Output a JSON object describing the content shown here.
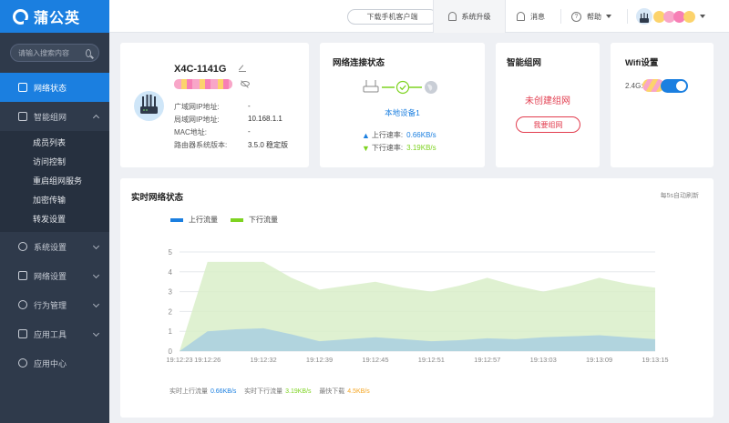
{
  "brand": {
    "name": "蒲公英",
    "accent": "#1b7fe0"
  },
  "search": {
    "placeholder": "请输入搜索内容"
  },
  "sidebar": {
    "items": [
      {
        "label": "网络状态",
        "icon": "network-status-icon",
        "active": true
      },
      {
        "label": "智能组网",
        "icon": "smart-mesh-icon",
        "expanded": true,
        "children": [
          "成员列表",
          "访问控制",
          "重启组网服务",
          "加密传输",
          "转发设置"
        ]
      },
      {
        "label": "系统设置",
        "icon": "system-settings-icon"
      },
      {
        "label": "网络设置",
        "icon": "network-settings-icon"
      },
      {
        "label": "行为管理",
        "icon": "behavior-icon"
      },
      {
        "label": "应用工具",
        "icon": "tools-icon"
      },
      {
        "label": "应用中心",
        "icon": "app-center-icon"
      }
    ]
  },
  "topbar": {
    "download_label": "下载手机客户端",
    "upgrade_label": "系统升级",
    "messages_label": "消息",
    "help_label": "帮助"
  },
  "device": {
    "name": "X4C-1141G",
    "fields": [
      {
        "label": "广域网IP地址:",
        "value": "-"
      },
      {
        "label": "局域网IP地址:",
        "value": "10.168.1.1"
      },
      {
        "label": "MAC地址:",
        "value": "-"
      },
      {
        "label": "路由器系统版本:",
        "value": "3.5.0 稳定版"
      }
    ]
  },
  "network": {
    "title": "网络连接状态",
    "local_device": "本地设备1",
    "upload_label": "上行速率:",
    "upload_value": "0.66KB/s",
    "download_label": "下行速率:",
    "download_value": "3.19KB/s"
  },
  "mesh": {
    "title": "智能组网",
    "status": "未创建组网",
    "button": "我要组网"
  },
  "wifi": {
    "title": "Wifi设置",
    "band": "2.4G:",
    "enabled": true
  },
  "chart_section": {
    "title": "实时网络状态",
    "refresh_note": "每5s自动刷新",
    "footer": {
      "up_label": "实时上行流量",
      "up_value": "0.66KB/s",
      "down_label": "实时下行流量",
      "down_value": "3.19KB/s",
      "max_label": "最快下载",
      "max_value": "4.5KB/s"
    }
  },
  "chart_data": {
    "type": "area",
    "x": [
      "19:12:23",
      "19:12:26",
      "19:12:29",
      "19:12:32",
      "19:12:35",
      "19:12:39",
      "19:12:42",
      "19:12:45",
      "19:12:48",
      "19:12:51",
      "19:12:54",
      "19:12:57",
      "19:13:00",
      "19:13:03",
      "19:13:06",
      "19:13:09",
      "19:13:12",
      "19:13:15"
    ],
    "tick_labels": [
      "19:12:23",
      "19:12:26",
      "19:12:32",
      "19:12:39",
      "19:12:45",
      "19:12:51",
      "19:12:57",
      "19:13:03",
      "19:13:09",
      "19:13:15"
    ],
    "series": [
      {
        "name": "上行流量",
        "color": "#1b7fe0",
        "fill": "#a9cfe0",
        "values": [
          0,
          1.0,
          1.1,
          1.15,
          0.85,
          0.5,
          0.6,
          0.7,
          0.6,
          0.5,
          0.55,
          0.65,
          0.6,
          0.7,
          0.75,
          0.8,
          0.7,
          0.6
        ]
      },
      {
        "name": "下行流量",
        "color": "#7ed321",
        "fill": "#d9efc9",
        "values": [
          0,
          4.5,
          4.5,
          4.5,
          3.7,
          3.1,
          3.3,
          3.5,
          3.2,
          3.0,
          3.3,
          3.7,
          3.3,
          3.0,
          3.3,
          3.7,
          3.4,
          3.2
        ]
      }
    ],
    "ylim": [
      0,
      5
    ],
    "yticks": [
      0,
      1,
      2,
      3,
      4,
      5
    ],
    "grid": true,
    "legend": "top-left"
  }
}
